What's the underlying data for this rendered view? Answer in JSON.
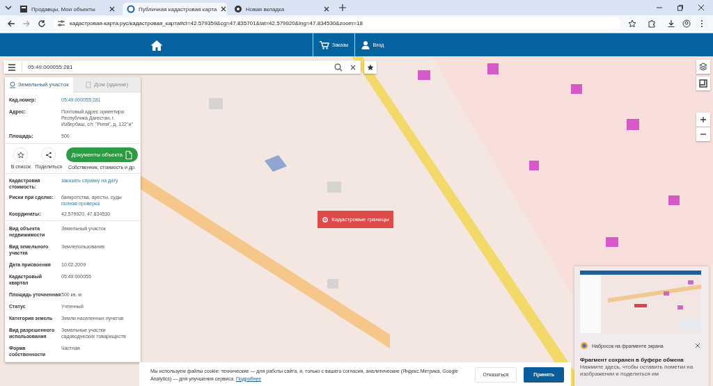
{
  "browser": {
    "tabs": [
      {
        "title": "Продавцы, Мои объекты",
        "selected": false
      },
      {
        "title": "Публичная кадастровая карта",
        "selected": true
      },
      {
        "title": "Новая вкладка",
        "selected": false
      }
    ],
    "url": "кадастровая-карта.рус/кадастровая_карта#ct=42.579359&cg=47.835701&lat=42.579920&lng=47.834530&zoom=18"
  },
  "header": {
    "nav": [
      {
        "label": "Заказы",
        "kind": "cart"
      },
      {
        "label": "Вход",
        "kind": "user"
      }
    ]
  },
  "search": {
    "value": "05:49:000055:281"
  },
  "panel": {
    "tabs": [
      {
        "label": "Земельный участок",
        "selected": true,
        "disabled": false
      },
      {
        "label": "Дом (здание)",
        "selected": false,
        "disabled": true
      }
    ],
    "fields": [
      {
        "label": "Кад.номер:",
        "values": [
          {
            "text": "05:49:000055:281",
            "kind": "link"
          }
        ]
      },
      {
        "label": "Адрес:",
        "values": [
          {
            "text": "Почтовый адрес ориентира: Республика Дагестан, г. Избербаш, с/т. \"Ритм\", д. 122\"и\"",
            "kind": "text"
          }
        ]
      },
      {
        "label": "Площадь:",
        "values": [
          {
            "text": "500",
            "kind": "text"
          }
        ]
      }
    ],
    "actions": [
      {
        "label": "В список",
        "kind": "star"
      },
      {
        "label": "Поделиться",
        "kind": "share"
      }
    ],
    "documents": {
      "label": "Документы объекта",
      "caption": "Собственник, стоимость и др."
    },
    "summary": [
      {
        "label": "Кадастровая стоимость:",
        "values": [
          {
            "text": "заказать справку на дату",
            "kind": "link"
          }
        ]
      },
      {
        "label": "Риски при сделке:",
        "values": [
          {
            "text": "банкротства, аресты, суды",
            "kind": "text"
          },
          {
            "text": "полная проверка",
            "kind": "link"
          }
        ]
      },
      {
        "label": "Координаты:",
        "values": [
          {
            "text": "42.579920, 47.834530",
            "kind": "text"
          }
        ]
      }
    ],
    "details": [
      {
        "label": "Вид объекта недвижимости",
        "value": "Земельный участок"
      },
      {
        "label": "Вид земельного участка",
        "value": "Землепользование"
      },
      {
        "label": "Дата присвоения",
        "value": "10.02.2009"
      },
      {
        "label": "Кадастровый квартал",
        "value": "05:49:000055"
      },
      {
        "label": "Площадь уточненная",
        "value": "500 кв. м"
      },
      {
        "label": "Статус",
        "value": "Учтенный"
      },
      {
        "label": "Категория земель",
        "value": "Земли населенных пунктов"
      },
      {
        "label": "Вид разрешенного использования",
        "value": "Земельные участки садоводческих товариществ"
      },
      {
        "label": "Форма собственности",
        "value": "Частная"
      }
    ]
  },
  "map": {
    "overlay_button": "Кадастровые границы"
  },
  "cookie": {
    "text": "Мы используем файлы cookie: технические — для работы сайта, и, только с вашего согласия, аналитические (Яндекс.Метрика, Google Analytics) — для улучшения сервиса.",
    "link": "Подробнее",
    "buttons": [
      {
        "label": "Отказаться",
        "kind": "secondary"
      },
      {
        "label": "Принять",
        "kind": "primary"
      }
    ]
  },
  "notification": {
    "app": "Набросок на фрагменте экрана",
    "title": "Фрагмент сохранен в буфере обмена",
    "body": "Нажмите здесь, чтобы оставить пометки на изображении и поделиться им"
  }
}
